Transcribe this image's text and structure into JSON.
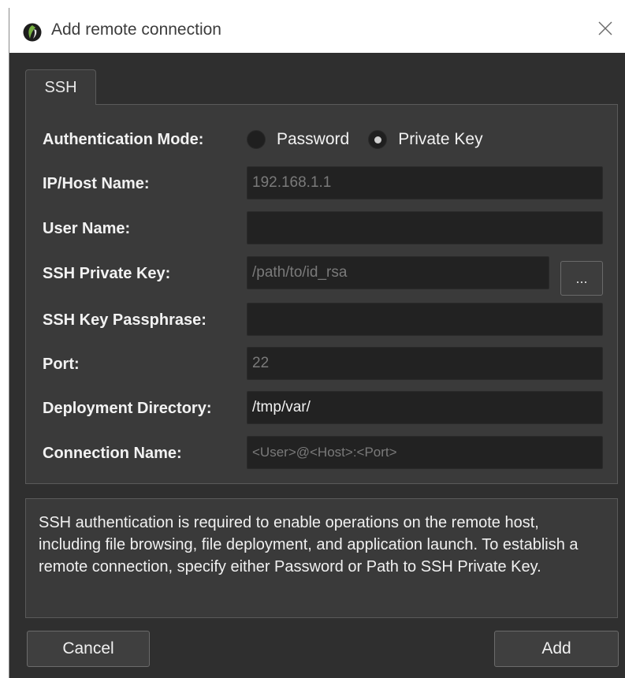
{
  "window": {
    "title": "Add remote connection",
    "close_icon": "✕"
  },
  "tabs": [
    {
      "label": "SSH"
    }
  ],
  "form": {
    "auth_mode": {
      "label": "Authentication Mode:",
      "options": [
        {
          "label": "Password",
          "selected": false
        },
        {
          "label": "Private Key",
          "selected": true
        }
      ]
    },
    "host": {
      "label": "IP/Host Name:",
      "value": "",
      "placeholder": "192.168.1.1"
    },
    "user": {
      "label": "User Name:",
      "value": "",
      "placeholder": ""
    },
    "private_key": {
      "label": "SSH Private Key:",
      "value": "",
      "placeholder": "/path/to/id_rsa",
      "browse_label": "..."
    },
    "passphrase": {
      "label": "SSH Key Passphrase:",
      "value": "",
      "placeholder": ""
    },
    "port": {
      "label": "Port:",
      "value": "",
      "placeholder": "22"
    },
    "deploy_dir": {
      "label": "Deployment Directory:",
      "value": "/tmp/var/",
      "placeholder": ""
    },
    "connection_name": {
      "label": "Connection Name:",
      "value": "",
      "placeholder": "<User>@<Host>:<Port>"
    }
  },
  "info_text": "SSH authentication is required to enable operations on the remote host, including file browsing, file deployment, and application launch. To establish a remote connection, specify either Password or Path to SSH Private Key.",
  "buttons": {
    "cancel": "Cancel",
    "add": "Add"
  },
  "colors": {
    "background": "#2f2f2f",
    "panel": "#3a3a3a",
    "input": "#222222",
    "app_icon_green": "#6ab04c"
  }
}
